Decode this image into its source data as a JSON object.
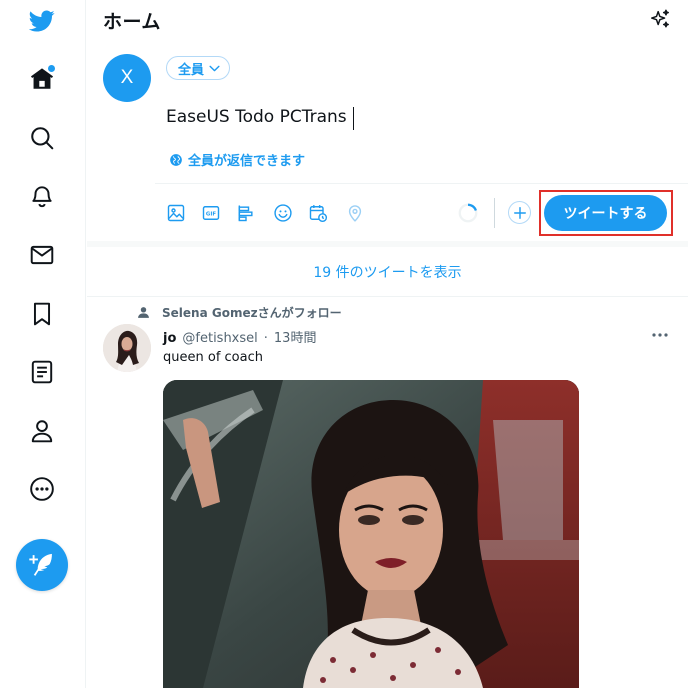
{
  "nav": {
    "items": [
      {
        "name": "twitter-logo",
        "icon": "twitter-bird"
      },
      {
        "name": "home",
        "icon": "home-icon",
        "has_notification_dot": true
      },
      {
        "name": "explore",
        "icon": "search-icon"
      },
      {
        "name": "notifications",
        "icon": "bell-icon"
      },
      {
        "name": "messages",
        "icon": "mail-icon"
      },
      {
        "name": "bookmarks",
        "icon": "bookmark-icon"
      },
      {
        "name": "lists",
        "icon": "list-icon"
      },
      {
        "name": "profile",
        "icon": "person-icon"
      },
      {
        "name": "more",
        "icon": "more-circle-icon"
      }
    ],
    "compose_icon": "feather-plus-icon"
  },
  "header": {
    "title": "ホーム",
    "sparkle_icon": "sparkle-icon"
  },
  "composer": {
    "avatar_letter": "X",
    "audience_label": "全員",
    "text": "EaseUS Todo PCTrans",
    "reply_setting": "全員が返信できます",
    "tools": [
      "image-icon",
      "gif-icon",
      "poll-icon",
      "emoji-icon",
      "schedule-icon",
      "location-icon"
    ],
    "gif_label": "GIF",
    "tweet_button": "ツイートする"
  },
  "timeline": {
    "show_new": "19 件のツイートを表示"
  },
  "tweet": {
    "social_context": "Selena Gomezさんがフォロー",
    "author": "jo",
    "handle": "@fetishxsel",
    "separator": "·",
    "time": "13時間",
    "text": "queen of coach"
  },
  "colors": {
    "accent": "#1d9bf0",
    "highlight_border": "#e0302a",
    "secondary_text": "#536471",
    "divider": "#eff3f4"
  }
}
